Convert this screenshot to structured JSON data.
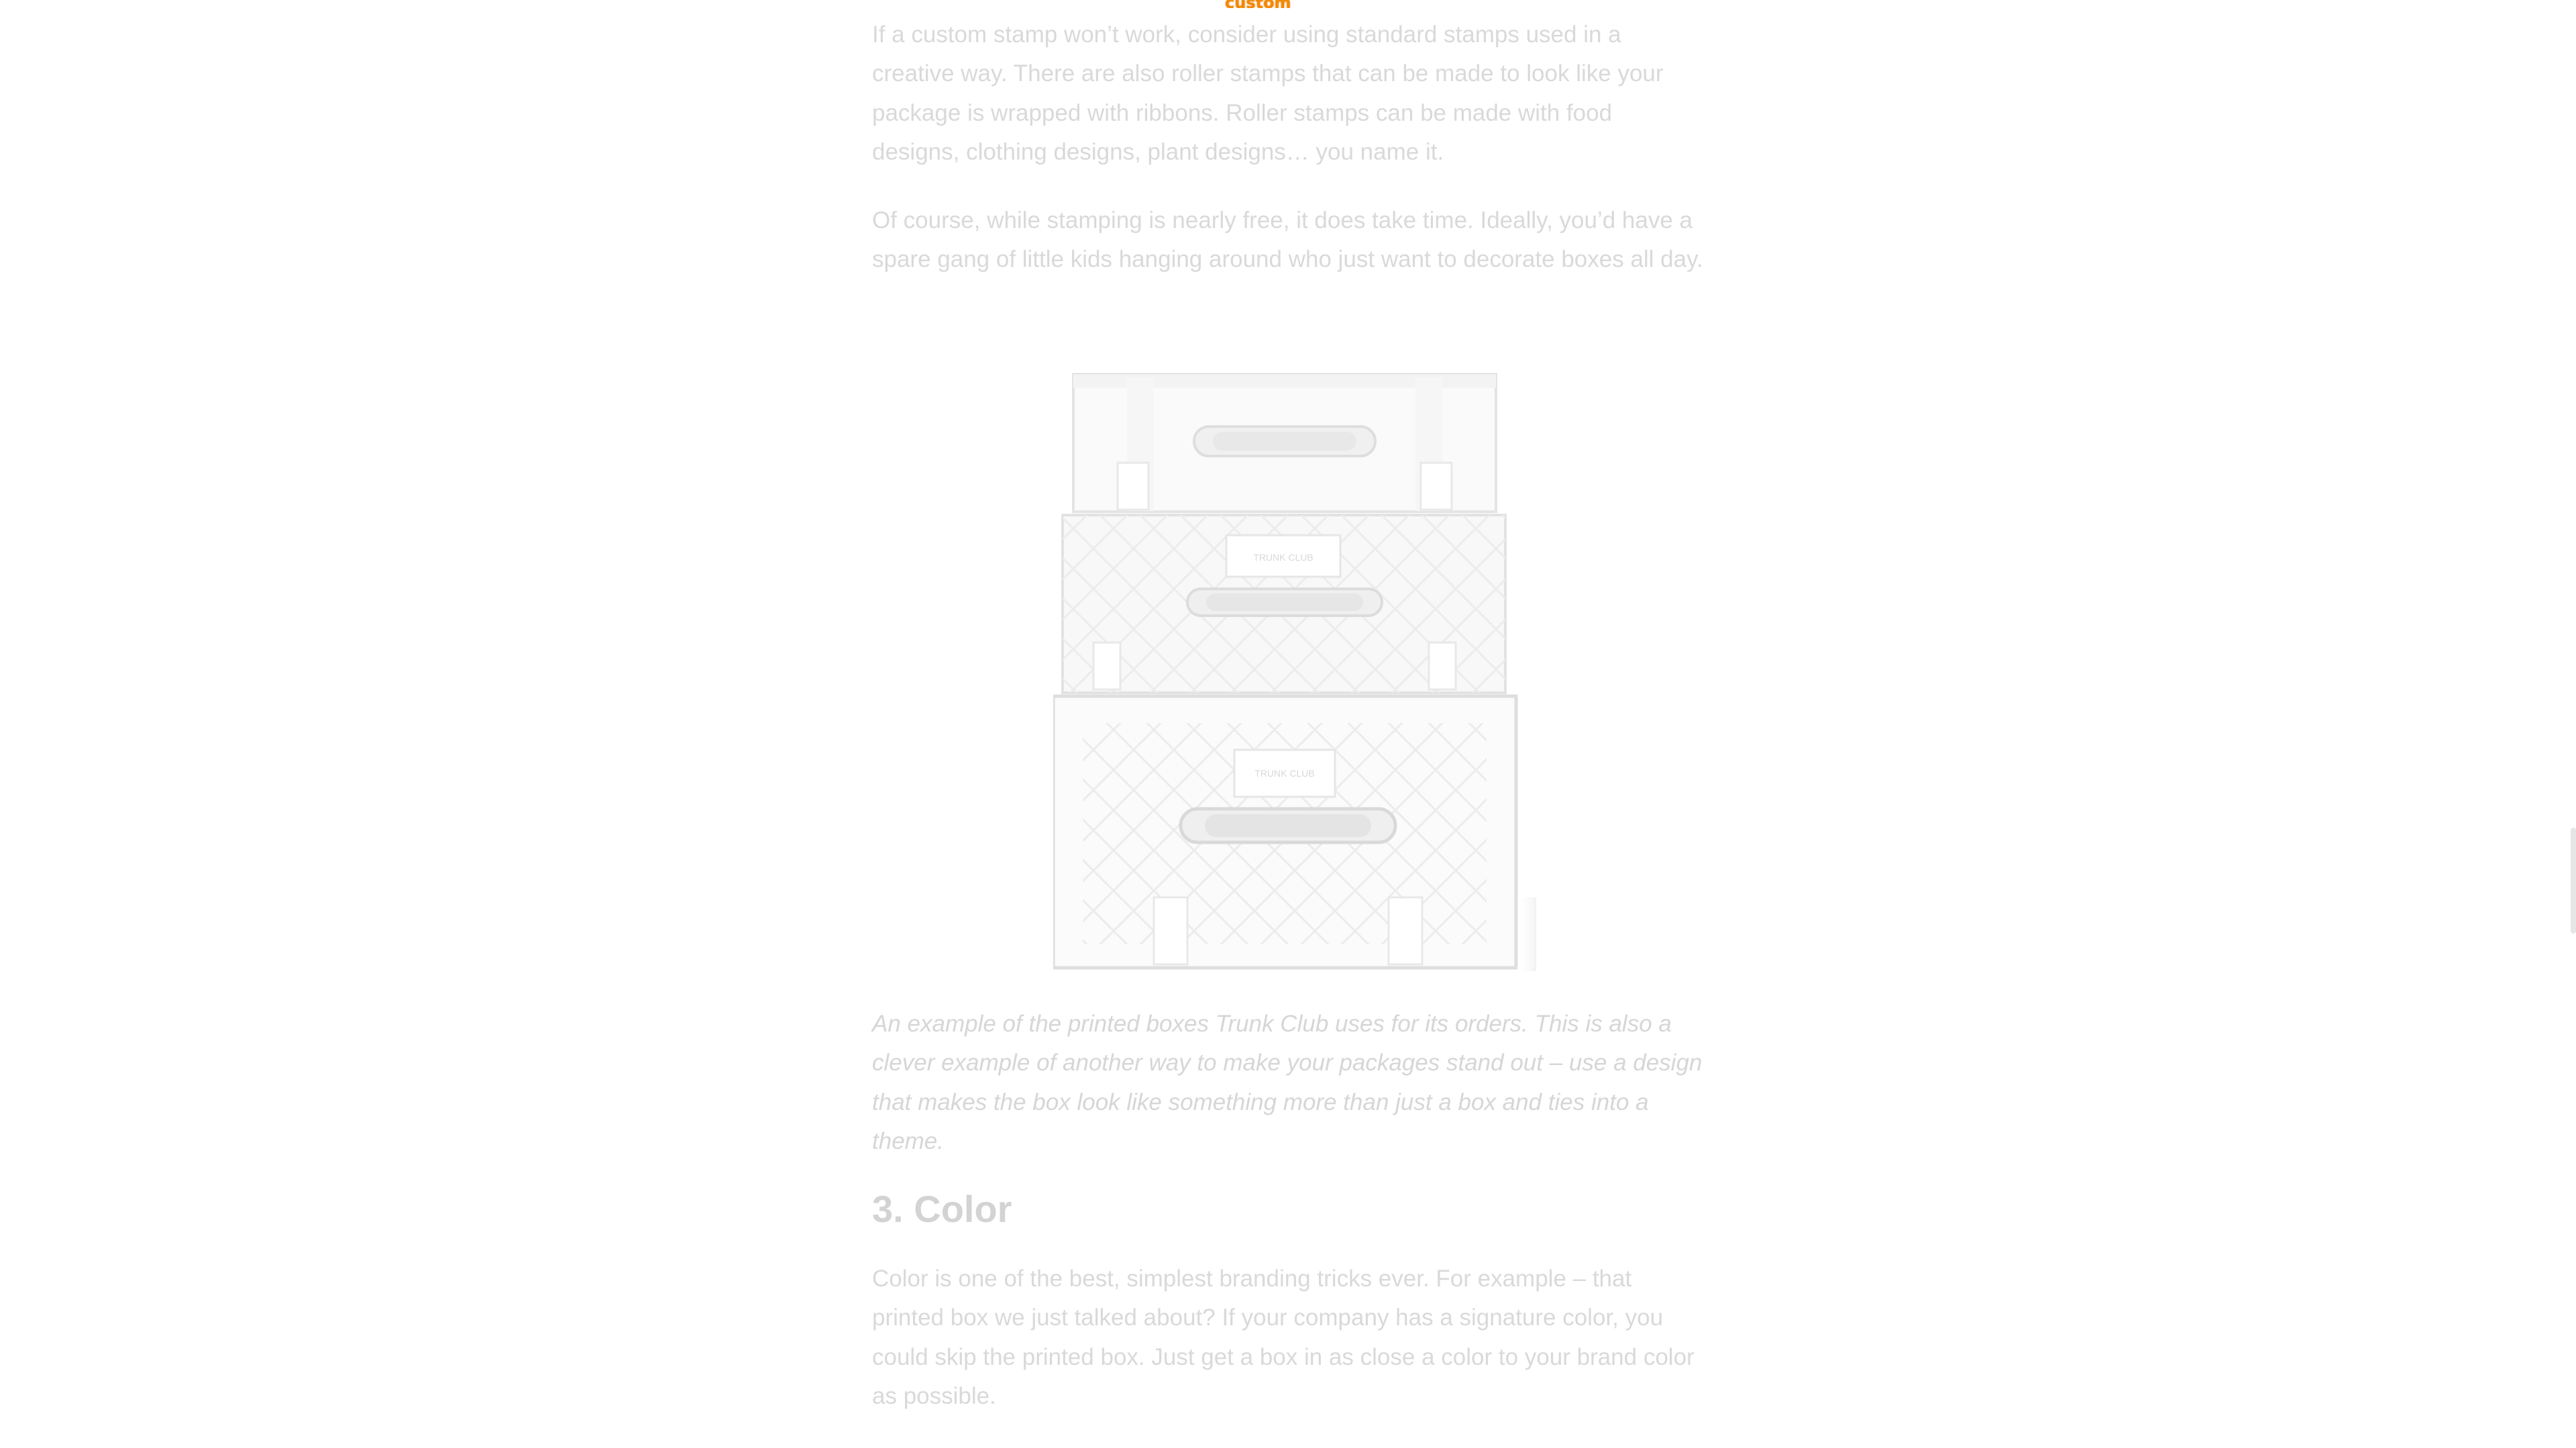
{
  "top_label": "custom stamp.",
  "article": {
    "paragraph_1": "If a custom stamp won’t work, consider using standard stamps used in a creative way. There are also roller stamps that can be made to look like your package is wrapped with ribbons. Roller stamps can be made with food designs, clothing designs, plant designs… you name it.",
    "paragraph_2": "Of course, while stamping is nearly free, it does take time. Ideally, you’d have a spare gang of little kids hanging around who just want to decorate boxes all day.",
    "figure": {
      "box_label_middle": "TRUNK CLUB",
      "box_label_bottom": "TRUNK CLUB"
    },
    "caption": "An example of the printed boxes Trunk Club uses for its orders. This is also a clever example of another way to make your packages stand out – use a design that makes the box look like something more than just a box and ties into a theme.",
    "heading": "3. Color",
    "paragraph_3": "Color is one of the best, simplest branding tricks ever. For example – that printed box we just talked about? If your company has a signature color, you could skip the printed box. Just get a box in as close a color to your brand color as possible."
  }
}
